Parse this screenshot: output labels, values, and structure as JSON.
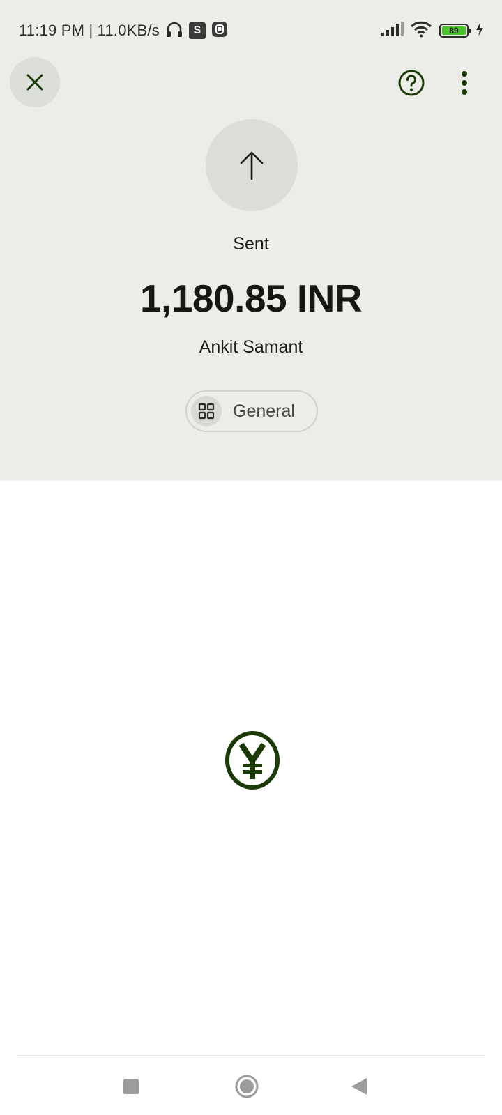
{
  "status_bar": {
    "time_speed": "11:19 PM | 11.0KB/s",
    "s_app_letter": "S",
    "battery_level": "89",
    "icons": [
      "headset-icon",
      "s-app-icon",
      "app-notification-icon",
      "signal-icon",
      "wifi-icon",
      "battery-icon",
      "charging-icon"
    ]
  },
  "header": {
    "close_icon": "close-icon",
    "help_icon": "help-icon",
    "more_icon": "more-vert-icon"
  },
  "transaction": {
    "direction_icon": "arrow-up-icon",
    "status": "Sent",
    "amount": "1,180.85 INR",
    "recipient": "Ankit Samant",
    "category": {
      "icon": "grid-icon",
      "label": "General"
    }
  },
  "center_logo": {
    "icon": "yen-coin-icon",
    "color": "#1b3a06"
  },
  "nav_bar": {
    "items": [
      "recents-square-icon",
      "home-circle-icon",
      "back-triangle-icon"
    ]
  },
  "colors": {
    "header_bg": "#ecede8",
    "icon_dark_green": "#1b3a06",
    "text_primary": "#161814"
  }
}
